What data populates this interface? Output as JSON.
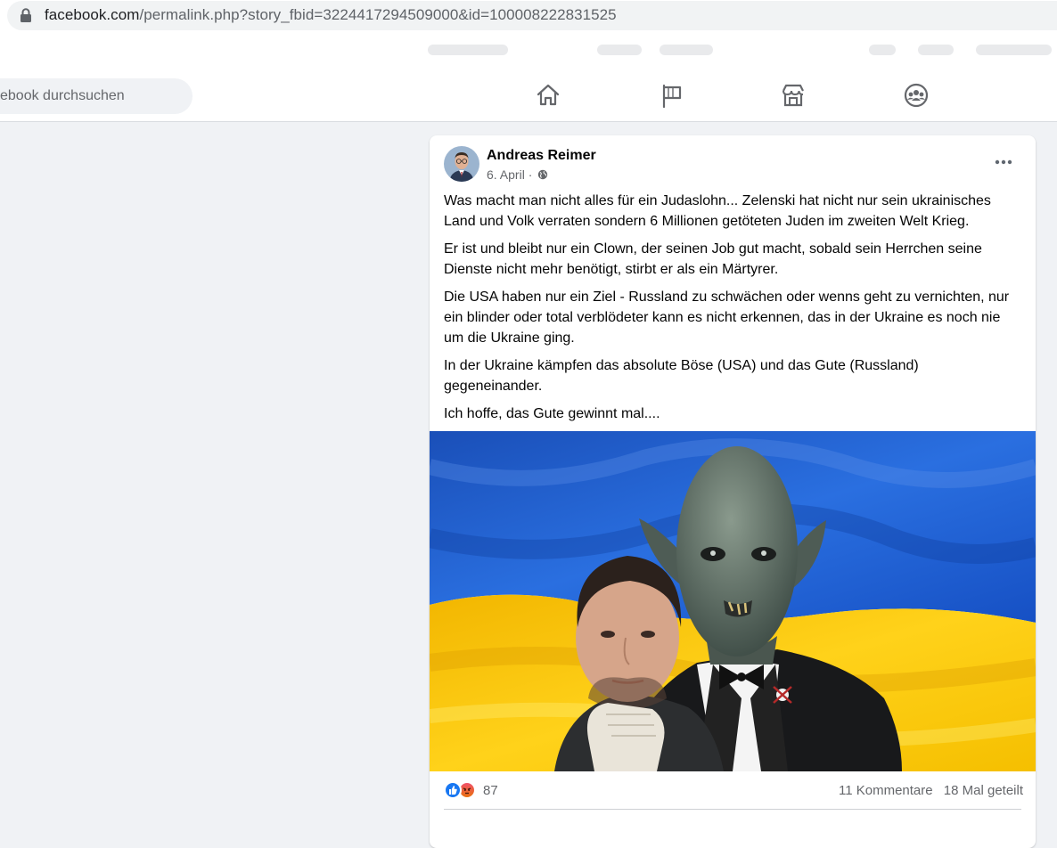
{
  "browser": {
    "url_host": "facebook.com",
    "url_rest": "/permalink.php?story_fbid=3224417294509000&id=100008222831525",
    "lock_icon": "lock-icon"
  },
  "header": {
    "search_text": "ebook durchsuchen",
    "nav_icons": [
      "home-icon",
      "flag-icon",
      "marketplace-icon",
      "groups-icon"
    ]
  },
  "post": {
    "author": "Andreas Reimer",
    "date": "6. April",
    "date_separator": "·",
    "privacy_icon": "globe-icon",
    "paragraphs": [
      "Was macht man nicht alles für ein Judaslohn... Zelenski hat nicht nur sein ukrainisches Land und Volk verraten sondern 6 Millionen getöteten Juden im zweiten Welt Krieg.",
      "Er ist und bleibt nur ein Clown, der seinen Job gut macht, sobald sein Herrchen seine Dienste nicht mehr benötigt, stirbt er als ein Märtyrer.",
      "Die USA haben nur ein Ziel - Russland zu schwächen oder wenns geht zu vernichten, nur ein blinder oder total verblödeter kann es nicht erkennen, das in der Ukraine es noch nie um die Ukraine ging.",
      "In der Ukraine kämpfen das absolute Böse (USA) und das Gute (Russland) gegeneinander.",
      "Ich hoffe, das Gute gewinnt mal...."
    ],
    "reactions": {
      "icons": [
        "like-reaction-icon",
        "angry-reaction-icon"
      ],
      "count": "87",
      "comments": "11 Kommentare",
      "shares": "18 Mal geteilt"
    },
    "colors": {
      "flag_blue": "#1a5fd0",
      "flag_yellow": "#ffd21a",
      "like_blue": "#1877f2"
    }
  }
}
